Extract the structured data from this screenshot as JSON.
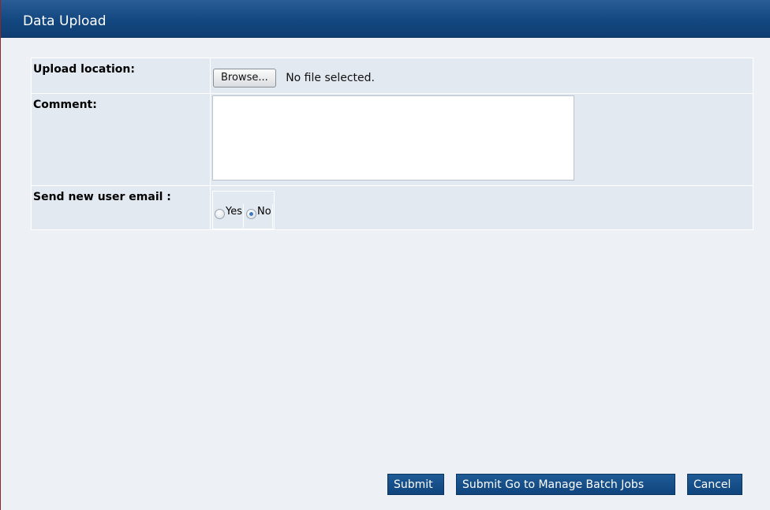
{
  "window": {
    "title": "Data Upload"
  },
  "form": {
    "upload_location_label": "Upload location:",
    "browse_button": "Browse...",
    "file_status": "No file selected.",
    "comment_label": "Comment:",
    "comment_value": "",
    "send_email_label": "Send new user email :",
    "radio_yes": "Yes",
    "radio_no": "No",
    "selected_option": "No"
  },
  "actions": {
    "submit": "Submit",
    "submit_go_batch": "Submit Go to Manage Batch Jobs",
    "cancel": "Cancel"
  },
  "colors": {
    "header": "#13477f",
    "button": "#154a84",
    "panel": "#edf1f6",
    "row": "#e3e9f1"
  }
}
